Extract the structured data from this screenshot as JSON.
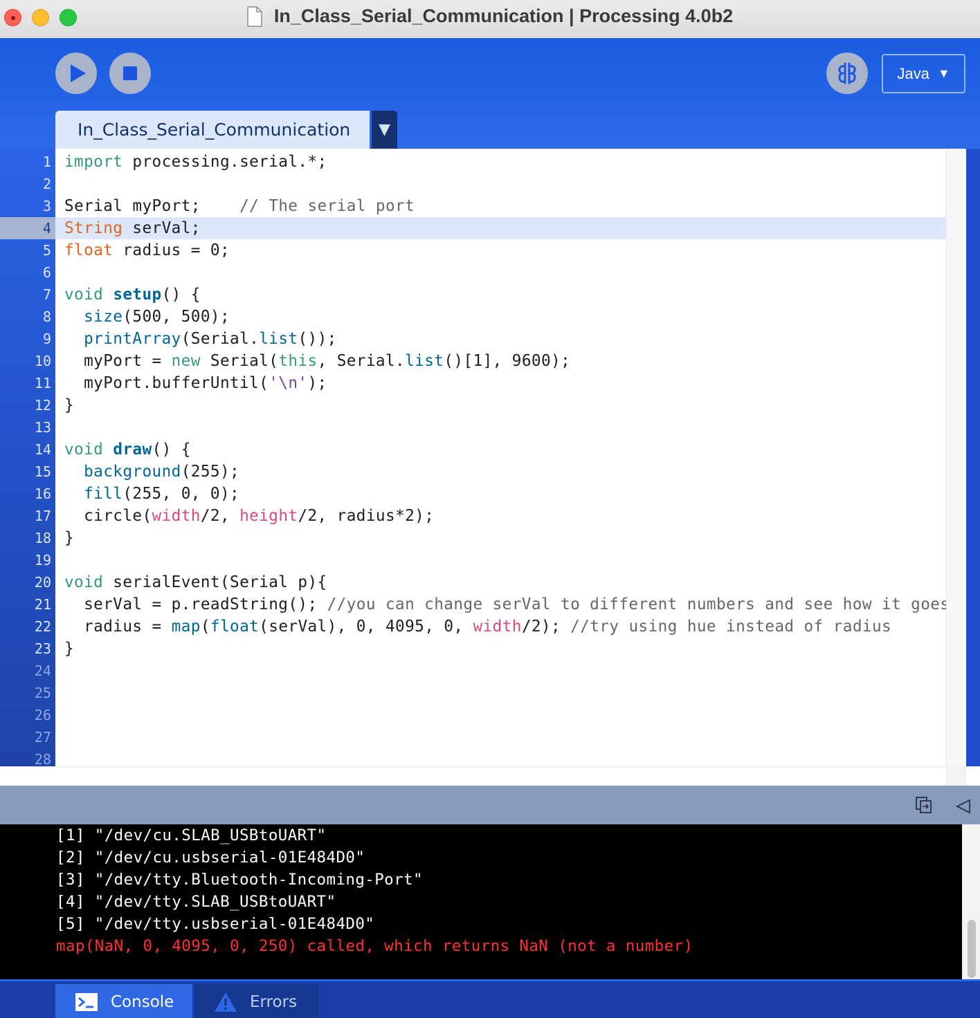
{
  "window": {
    "title": "In_Class_Serial_Communication | Processing 4.0b2"
  },
  "toolbar": {
    "run_icon": "play-icon",
    "stop_icon": "stop-icon",
    "debug_icon": "butterfly-icon",
    "mode_label": "Java",
    "mode_arrow": "▼"
  },
  "tab": {
    "label": "In_Class_Serial_Communication",
    "menu_arrow": "▼"
  },
  "editor": {
    "line_numbers": [
      "1",
      "2",
      "3",
      "4",
      "5",
      "6",
      "7",
      "8",
      "9",
      "10",
      "11",
      "12",
      "13",
      "14",
      "15",
      "16",
      "17",
      "18",
      "19",
      "20",
      "21",
      "22",
      "23",
      "24",
      "25",
      "26",
      "27",
      "28"
    ],
    "current_line": "4",
    "code": {
      "l1_kw": "import",
      "l1_rest": " processing.serial.*;",
      "l3_a": "Serial myPort;    ",
      "l3_cm": "// The serial port",
      "l4_ty": "String",
      "l4_rest": " serVal;",
      "l5_ty": "float",
      "l5_rest": " radius = 0;",
      "l7_kw": "void",
      "l7_sp": " ",
      "l7_fn": "setup",
      "l7_rest": "() {",
      "l8_ind": "  ",
      "l8_fn": "size",
      "l8_rest": "(500, 500);",
      "l9_ind": "  ",
      "l9_fn": "printArray",
      "l9_a": "(Serial.",
      "l9_fn2": "list",
      "l9_rest": "());",
      "l10_a": "  myPort = ",
      "l10_kw": "new",
      "l10_b": " Serial(",
      "l10_kw2": "this",
      "l10_c": ", Serial.",
      "l10_fn": "list",
      "l10_rest": "()[1], 9600);",
      "l11_a": "  myPort.bufferUntil(",
      "l11_str": "'\\n'",
      "l11_rest": ");",
      "l12": "}",
      "l14_kw": "void",
      "l14_sp": " ",
      "l14_fn": "draw",
      "l14_rest": "() {",
      "l15_ind": "  ",
      "l15_fn": "background",
      "l15_rest": "(255);",
      "l16_ind": "  ",
      "l16_fn": "fill",
      "l16_rest": "(255, 0, 0);",
      "l17_a": "  circle(",
      "l17_v1": "width",
      "l17_b": "/2, ",
      "l17_v2": "height",
      "l17_rest": "/2, radius*2);",
      "l18": "}",
      "l20_kw": "void",
      "l20_rest": " serialEvent(Serial p){",
      "l21_a": "  serVal = p.readString(); ",
      "l21_cm": "//you can change serVal to different numbers and see how it goes",
      "l22_a": "  radius = ",
      "l22_fn": "map",
      "l22_b": "(",
      "l22_fn2": "float",
      "l22_c": "(serVal), 0, 4095, 0, ",
      "l22_v": "width",
      "l22_d": "/2); ",
      "l22_cm": "//try using hue instead of radius",
      "l23": "}"
    }
  },
  "console": {
    "lines": [
      "[1] \"/dev/cu.SLAB_USBtoUART\"",
      "[2] \"/dev/cu.usbserial-01E484D0\"",
      "[3] \"/dev/tty.Bluetooth-Incoming-Port\"",
      "[4] \"/dev/tty.SLAB_USBtoUART\"",
      "[5] \"/dev/tty.usbserial-01E484D0\""
    ],
    "error_line": "map(NaN, 0, 4095, 0, 250) called, which returns NaN (not a number)",
    "copy_icon": "copy-icon",
    "collapse_icon": "collapse-triangle-icon"
  },
  "bottom_tabs": {
    "console_label": "Console",
    "console_icon": "terminal-icon",
    "errors_label": "Errors",
    "errors_icon": "warning-icon"
  },
  "colors": {
    "accent_blue": "#1a5be0",
    "keyword": "#33997e",
    "type": "#e2661a",
    "function": "#006699",
    "error_text": "#ff3030"
  }
}
